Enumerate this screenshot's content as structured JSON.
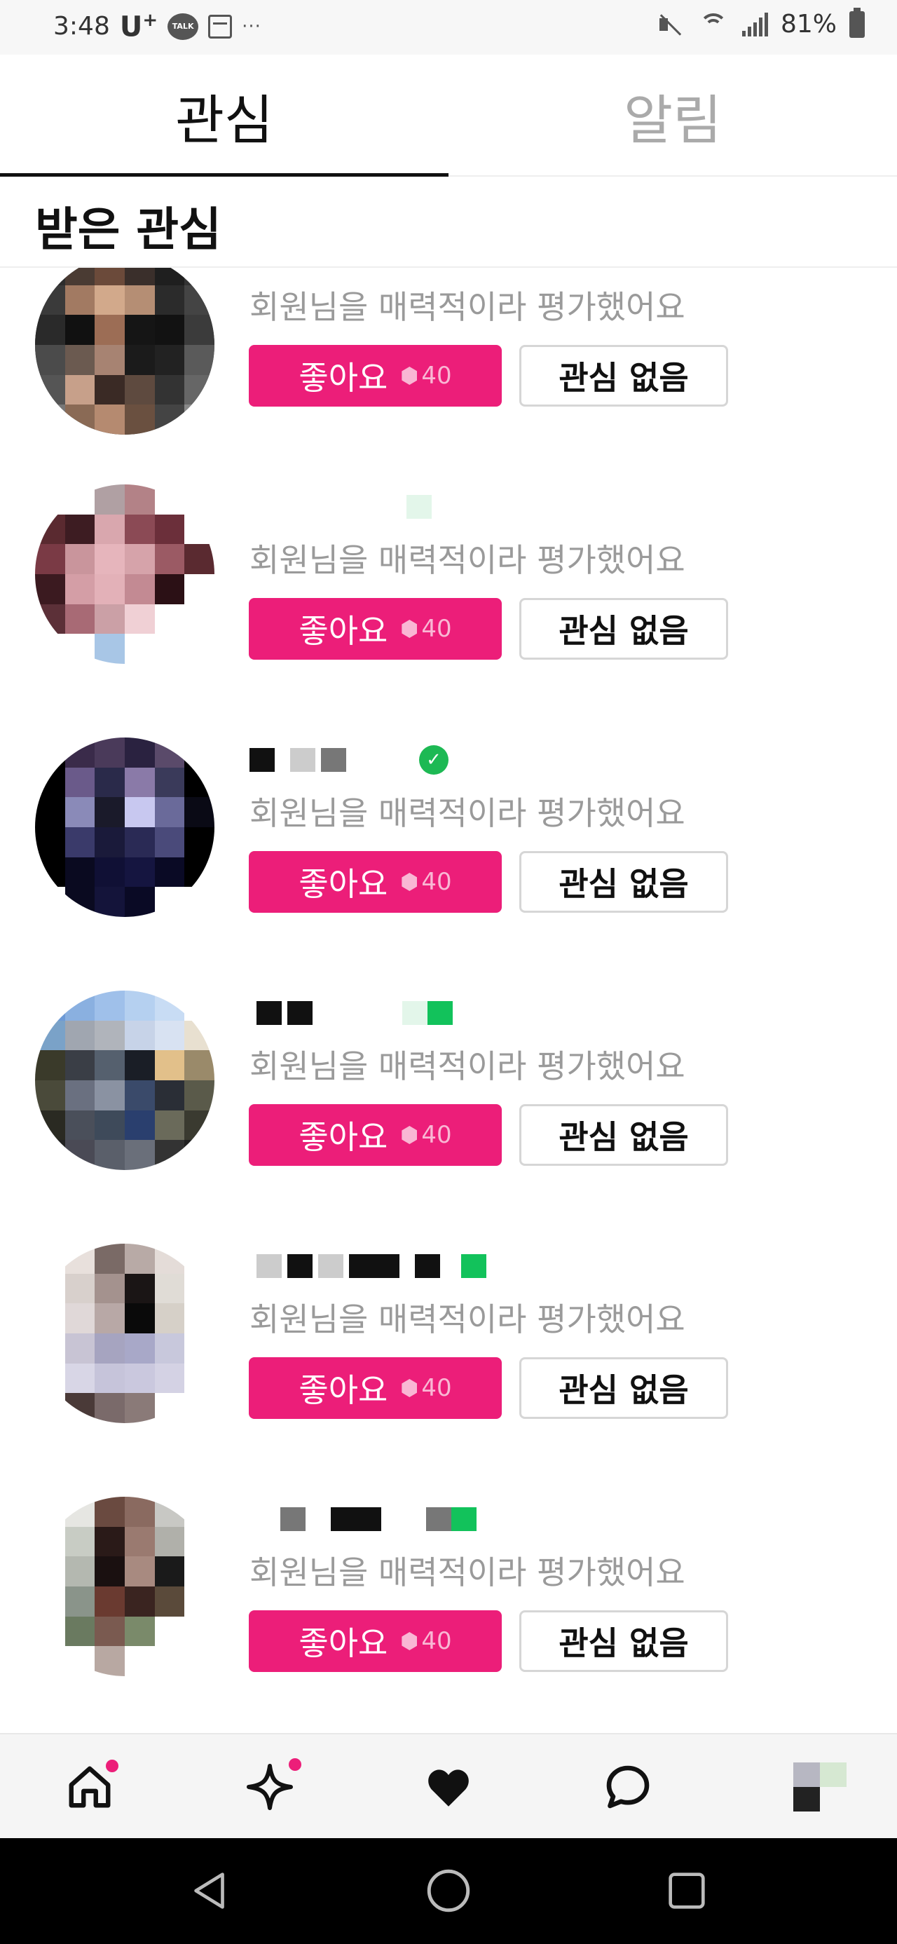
{
  "status_bar": {
    "time": "3:48",
    "carrier": "U",
    "carrier_sup": "+",
    "talk_label": "TALK",
    "more": "···",
    "battery": "81%",
    "icons": [
      "kakaotalk-icon",
      "calendar-icon",
      "mute-icon",
      "wifi-icon",
      "signal-icon",
      "battery-icon"
    ]
  },
  "tabs": [
    {
      "label": "관심",
      "active": true
    },
    {
      "label": "알림",
      "active": false
    }
  ],
  "section": {
    "title": "받은 관심"
  },
  "items": [
    {
      "name_blocks": [
        "g",
        "blk"
      ],
      "verified": true,
      "description": "회원님을 매력적이라 평가했어요",
      "like_label": "좋아요",
      "cost": "40",
      "pass_label": "관심 없음"
    },
    {
      "name_blocks": [],
      "verified": false,
      "description": "회원님을 매력적이라 평가했어요",
      "like_label": "좋아요",
      "cost": "40",
      "pass_label": "관심 없음"
    },
    {
      "name_blocks": [
        "blk",
        "g",
        "m"
      ],
      "verified": true,
      "description": "회원님을 매력적이라 평가했어요",
      "like_label": "좋아요",
      "cost": "40",
      "pass_label": "관심 없음"
    },
    {
      "name_blocks": [
        "blk",
        "blk"
      ],
      "verified": false,
      "description": "회원님을 매력적이라 평가했어요",
      "like_label": "좋아요",
      "cost": "40",
      "pass_label": "관심 없음"
    },
    {
      "name_blocks": [
        "g",
        "blk",
        "g",
        "blk",
        "blk"
      ],
      "verified": false,
      "description": "회원님을 매력적이라 평가했어요",
      "like_label": "좋아요",
      "cost": "40",
      "pass_label": "관심 없음"
    },
    {
      "name_blocks": [
        "m",
        "blk",
        "m"
      ],
      "verified": false,
      "description": "회원님을 매력적이라 평가했어요",
      "like_label": "좋아요",
      "cost": "40",
      "pass_label": "관심 없음"
    }
  ],
  "bottom_nav": [
    {
      "name": "home-icon",
      "badge": true
    },
    {
      "name": "sparkle-icon",
      "badge": true
    },
    {
      "name": "heart-icon",
      "badge": false
    },
    {
      "name": "chat-icon",
      "badge": false
    },
    {
      "name": "profile-avatar",
      "badge": false
    }
  ],
  "colors": {
    "accent": "#ec1e79",
    "verified": "#1db954",
    "inactive_tab": "#aaaaaa",
    "description": "#9a9a9a"
  }
}
